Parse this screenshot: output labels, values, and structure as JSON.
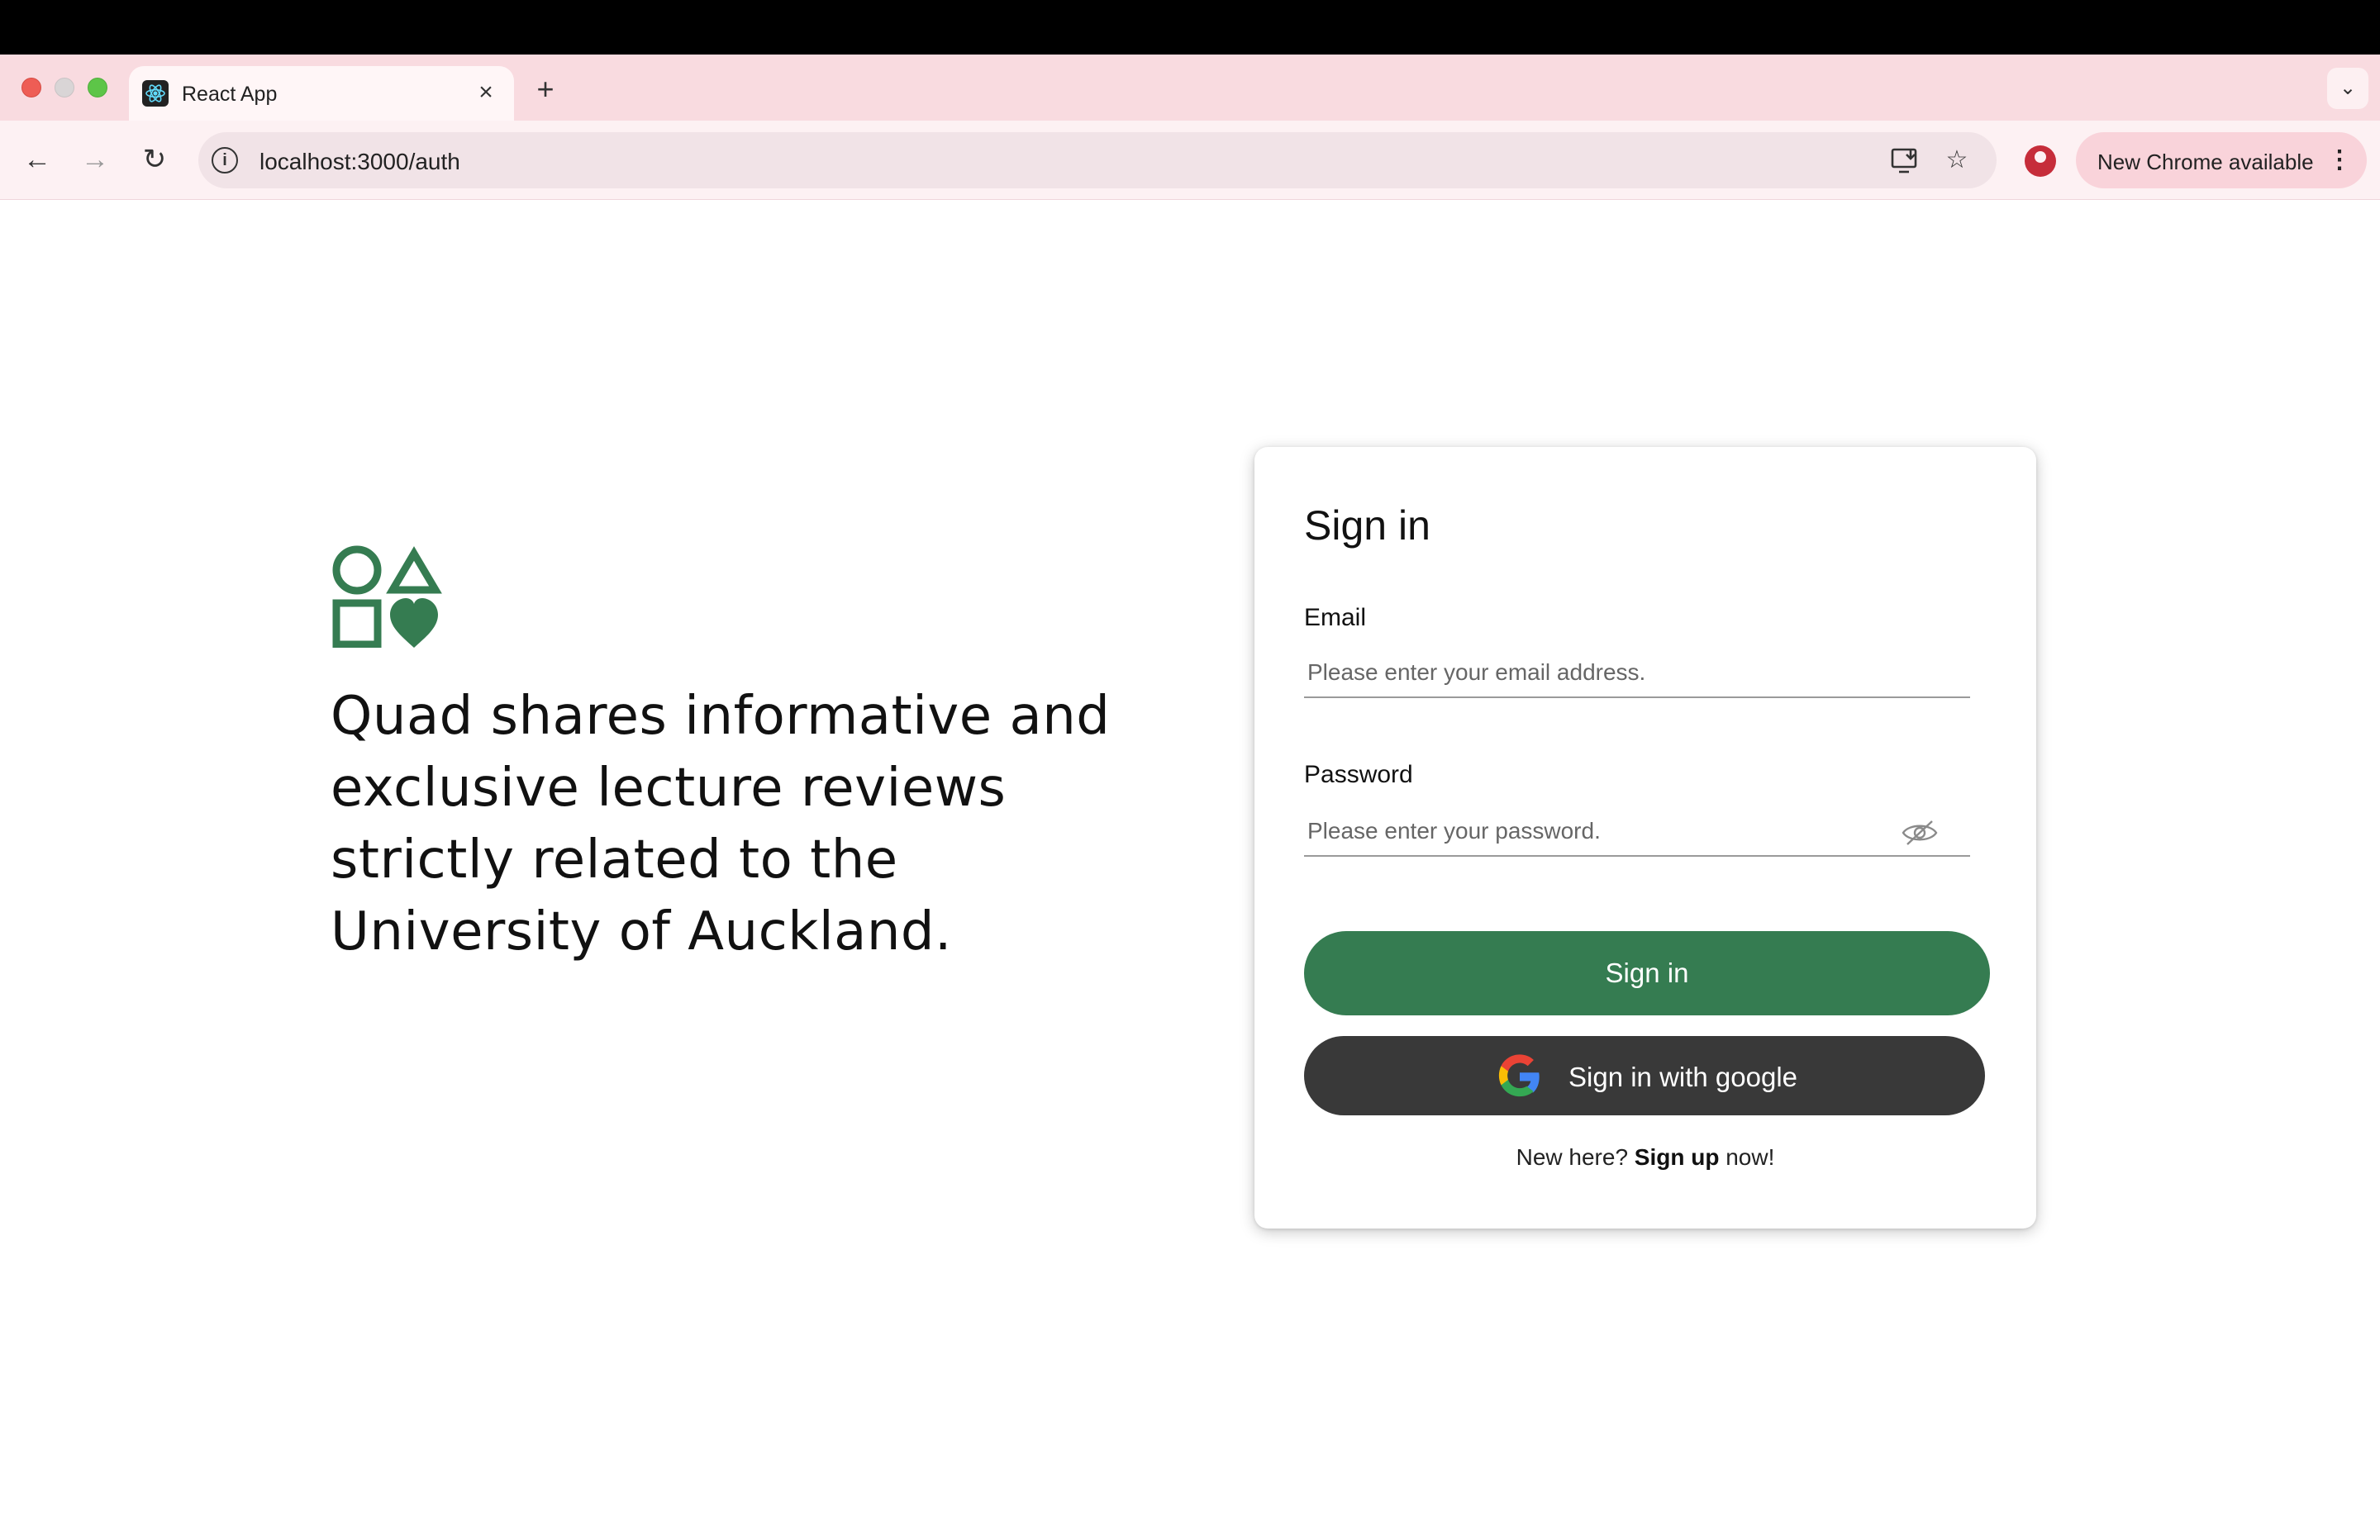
{
  "browser": {
    "tab_title": "React App",
    "url": "localhost:3000/auth",
    "update_label": "New Chrome available"
  },
  "hero": {
    "tagline_lines": [
      "Quad shares informative and",
      "exclusive lecture reviews",
      "strictly related to the",
      "University of Auckland."
    ]
  },
  "signin": {
    "title": "Sign in",
    "email_label": "Email",
    "email_placeholder": "Please enter your email address.",
    "password_label": "Password",
    "password_placeholder": "Please enter your password.",
    "submit_label": "Sign in",
    "google_label": "Sign in with google",
    "signup_prefix": "New here? ",
    "signup_link": "Sign up",
    "signup_suffix": " now!"
  },
  "colors": {
    "brand_green": "#357c51",
    "google_button": "#393939",
    "tab_strip": "#f9dbe0"
  },
  "icons": {
    "logo": "shapes-logo-icon",
    "password_toggle": "eye-off-icon",
    "google": "google-g-icon"
  }
}
